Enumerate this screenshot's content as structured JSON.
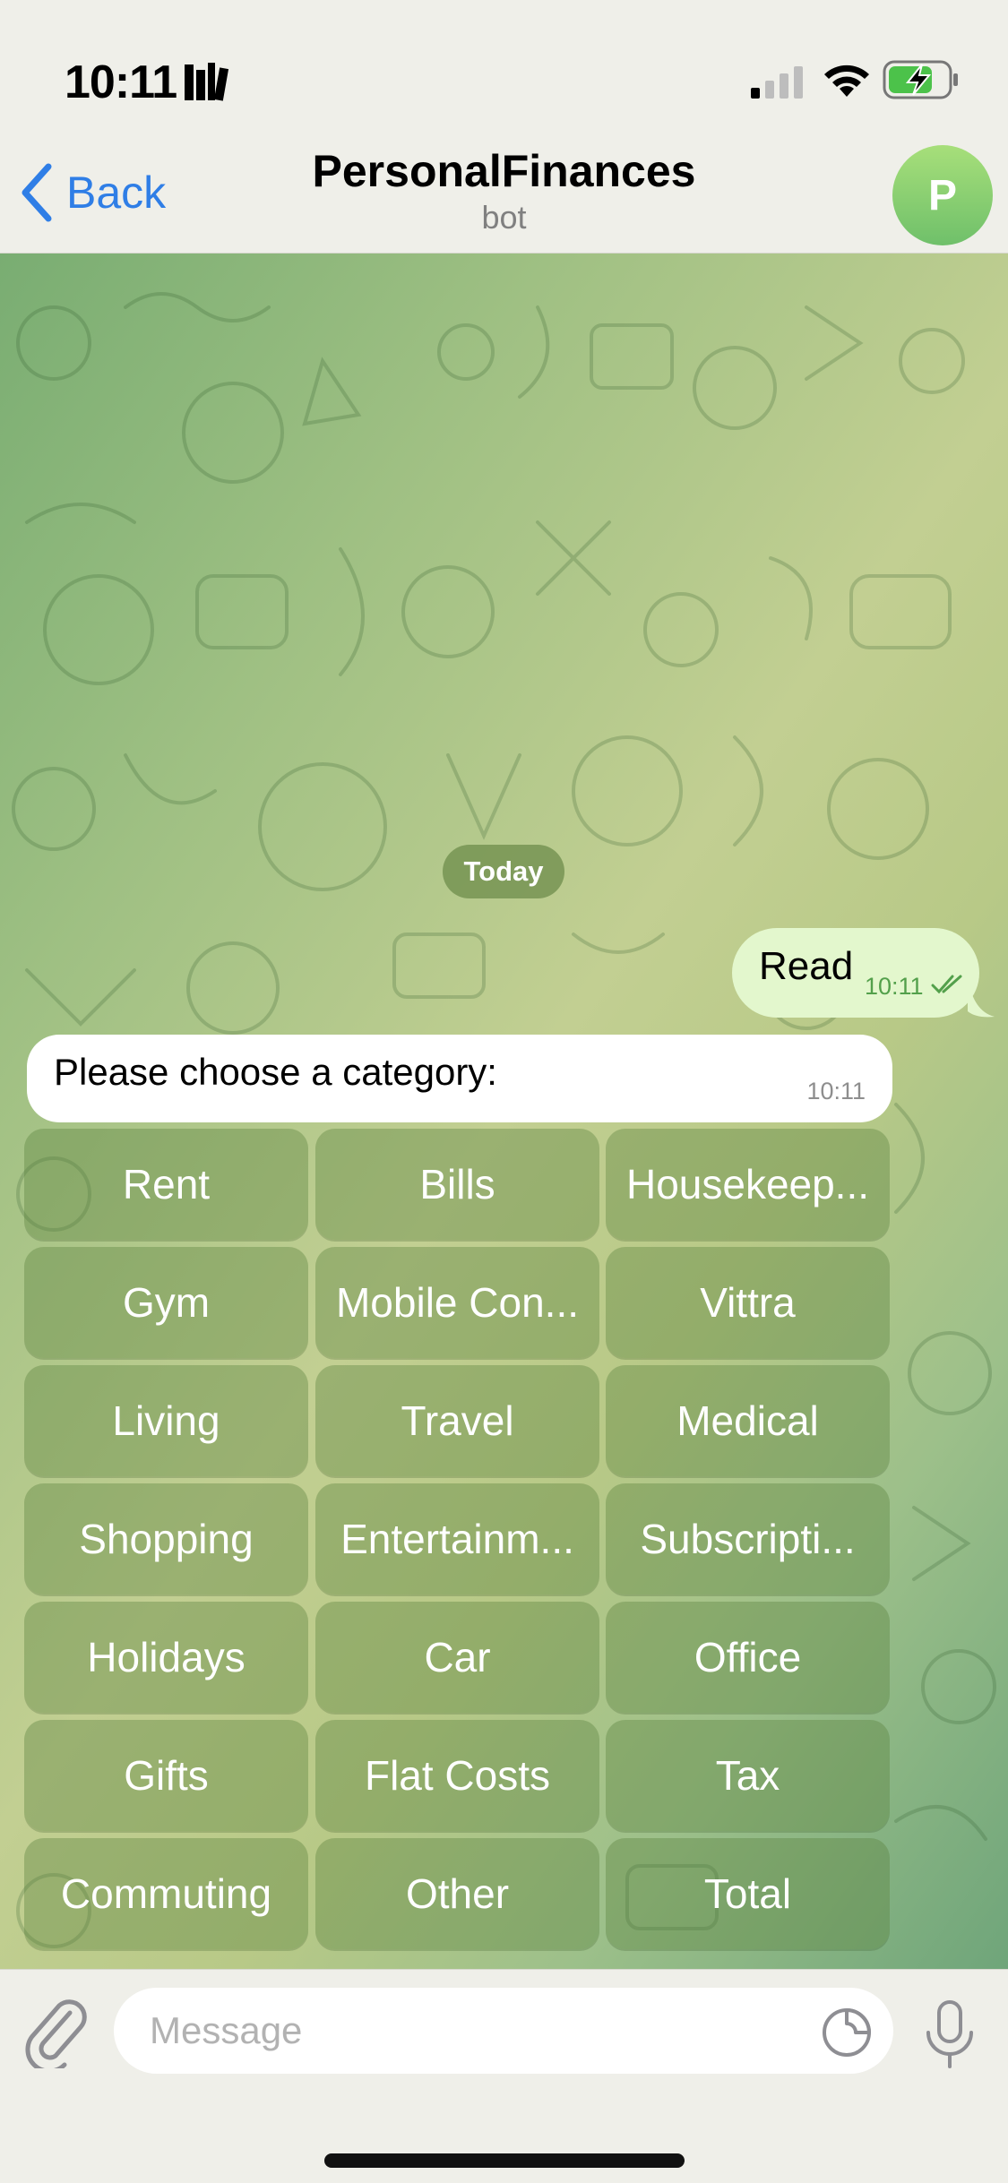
{
  "status_bar": {
    "time": "10:11"
  },
  "nav": {
    "back_label": "Back",
    "title": "PersonalFinances",
    "subtitle": "bot",
    "avatar_letter": "P"
  },
  "chat": {
    "date_chip": "Today",
    "outgoing": {
      "text": "Read",
      "time": "10:11",
      "status_icon": "double-check-icon"
    },
    "incoming": {
      "text": "Please choose a category:",
      "time": "10:11"
    },
    "keyboard": [
      [
        "Rent",
        "Bills",
        "Housekeep..."
      ],
      [
        "Gym",
        "Mobile Con...",
        "Vittra"
      ],
      [
        "Living",
        "Travel",
        "Medical"
      ],
      [
        "Shopping",
        "Entertainm...",
        "Subscripti..."
      ],
      [
        "Holidays",
        "Car",
        "Office"
      ],
      [
        "Gifts",
        "Flat Costs",
        "Tax"
      ],
      [
        "Commuting",
        "Other",
        "Total"
      ]
    ]
  },
  "input": {
    "placeholder": "Message"
  },
  "colors": {
    "accent": "#2f7ee6",
    "outgoing_bubble": "#e3f7cd",
    "avatar": "#7cc96d"
  }
}
